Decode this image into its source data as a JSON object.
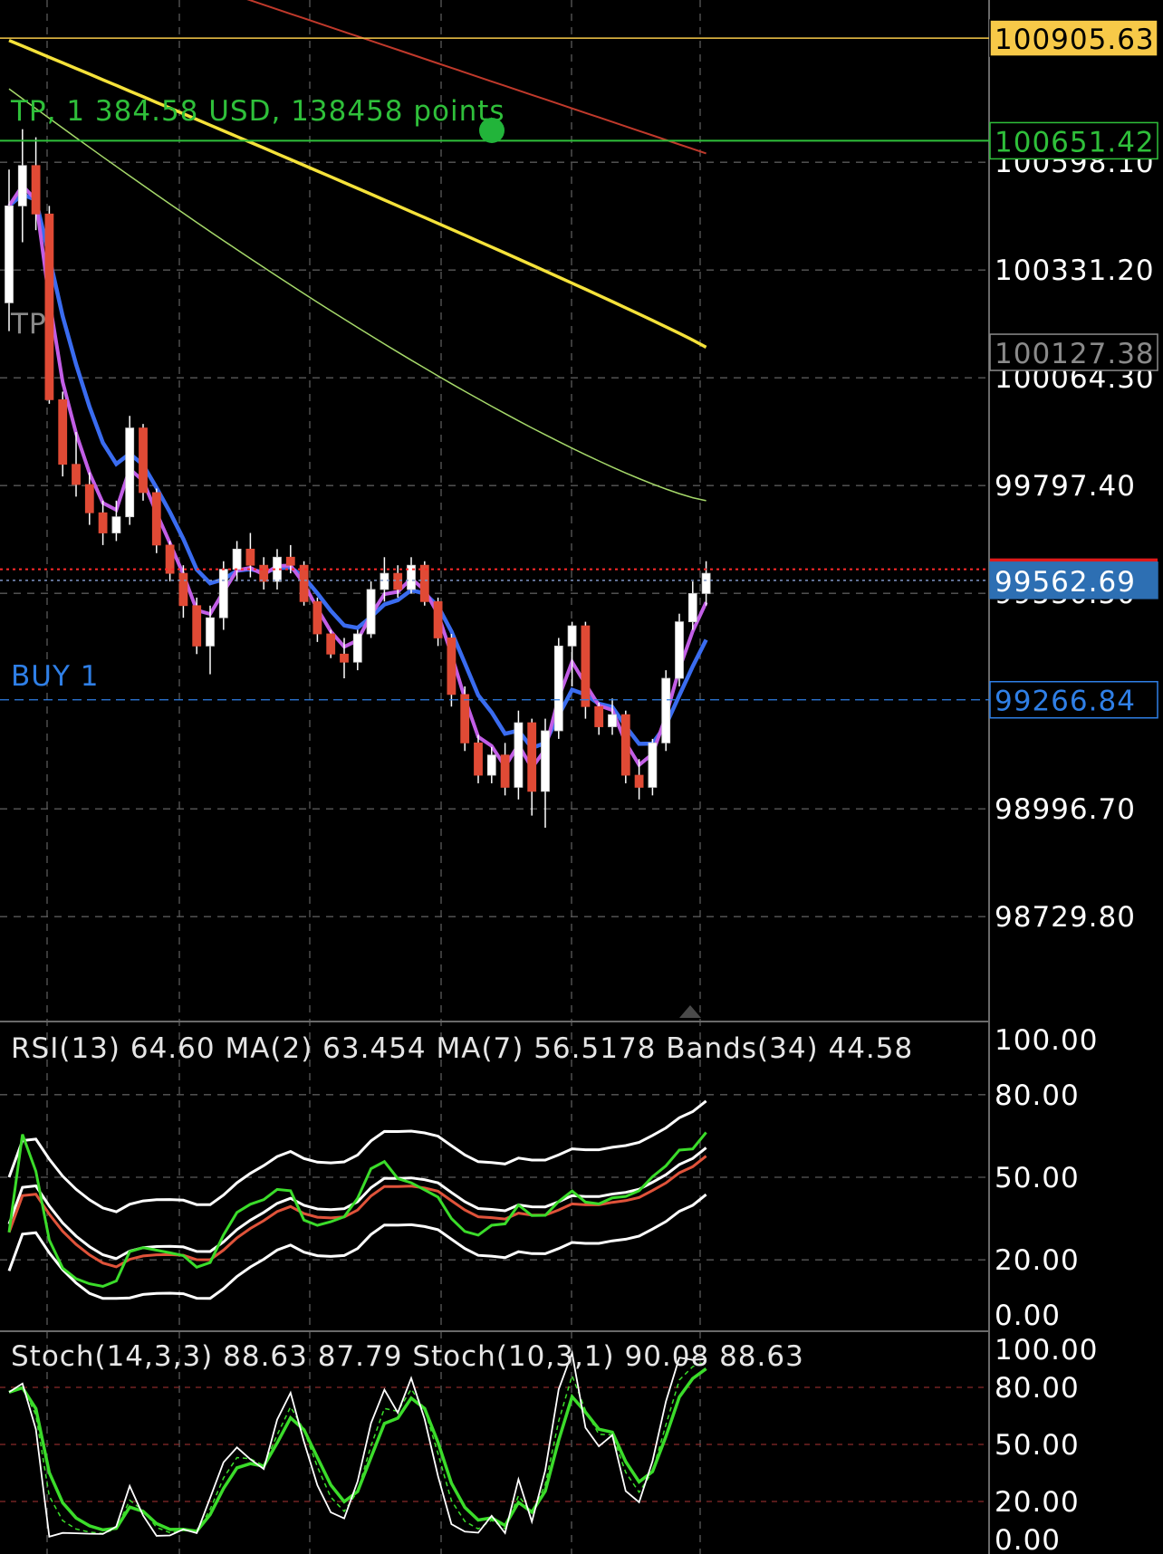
{
  "chart_data": {
    "type": "candlestick",
    "main": {
      "price_axis": {
        "ticks": [
          "100598.10",
          "100331.20",
          "100064.30",
          "99797.40",
          "99530.50",
          "98996.70",
          "98729.80"
        ],
        "range": [
          98470,
          101000
        ]
      },
      "price_tags": [
        {
          "label": "100905.63",
          "value": 100905.63,
          "kind": "bid-line",
          "bg": "#f7c948",
          "fg": "#000000"
        },
        {
          "label": "100651.42",
          "value": 100651.42,
          "kind": "tp-line",
          "bg": "#000000",
          "fg": "#2fbf3a"
        },
        {
          "label": "100127.38",
          "value": 100127.38,
          "kind": "tp-ghost",
          "bg": "#000000",
          "fg": "#8a8a8a"
        },
        {
          "label": "99562.69",
          "value": 99562.69,
          "kind": "current",
          "bg": "#2d6fb3",
          "fg": "#ffffff"
        },
        {
          "label": "99266.84",
          "value": 99266.84,
          "kind": "buy-line",
          "bg": "#000000",
          "fg": "#2f7fe6"
        }
      ],
      "ask_value": 99590,
      "annotations": [
        {
          "text": "TP, 1 384.58 USD, 138458 points",
          "color": "#2fbf3a"
        },
        {
          "text": "TP",
          "color": "#8a8a8a"
        },
        {
          "text": "BUY 1",
          "color": "#2f7fe6"
        }
      ],
      "candles": [
        [
          100250,
          100580,
          100180,
          100490
        ],
        [
          100490,
          100680,
          100400,
          100590
        ],
        [
          100590,
          100660,
          100430,
          100470
        ],
        [
          100470,
          100490,
          100000,
          100010
        ],
        [
          100010,
          100030,
          99820,
          99850
        ],
        [
          99850,
          99930,
          99770,
          99800
        ],
        [
          99800,
          99830,
          99700,
          99730
        ],
        [
          99730,
          99760,
          99650,
          99680
        ],
        [
          99680,
          99760,
          99660,
          99720
        ],
        [
          99720,
          99970,
          99700,
          99940
        ],
        [
          99940,
          99950,
          99760,
          99780
        ],
        [
          99780,
          99790,
          99630,
          99650
        ],
        [
          99650,
          99660,
          99560,
          99580
        ],
        [
          99580,
          99600,
          99470,
          99500
        ],
        [
          99500,
          99520,
          99380,
          99400
        ],
        [
          99400,
          99500,
          99330,
          99470
        ],
        [
          99470,
          99610,
          99440,
          99590
        ],
        [
          99590,
          99660,
          99560,
          99640
        ],
        [
          99640,
          99680,
          99570,
          99600
        ],
        [
          99600,
          99620,
          99540,
          99560
        ],
        [
          99560,
          99640,
          99540,
          99620
        ],
        [
          99620,
          99650,
          99580,
          99600
        ],
        [
          99600,
          99610,
          99500,
          99510
        ],
        [
          99510,
          99520,
          99410,
          99430
        ],
        [
          99430,
          99440,
          99370,
          99380
        ],
        [
          99380,
          99420,
          99320,
          99360
        ],
        [
          99360,
          99440,
          99340,
          99430
        ],
        [
          99430,
          99560,
          99420,
          99540
        ],
        [
          99540,
          99620,
          99510,
          99580
        ],
        [
          99580,
          99600,
          99520,
          99540
        ],
        [
          99540,
          99620,
          99530,
          99600
        ],
        [
          99600,
          99610,
          99500,
          99510
        ],
        [
          99510,
          99520,
          99400,
          99420
        ],
        [
          99420,
          99430,
          99250,
          99280
        ],
        [
          99280,
          99300,
          99140,
          99160
        ],
        [
          99160,
          99180,
          99060,
          99080
        ],
        [
          99080,
          99150,
          99060,
          99130
        ],
        [
          99130,
          99160,
          99030,
          99050
        ],
        [
          99050,
          99240,
          99020,
          99210
        ],
        [
          99210,
          99220,
          98980,
          99040
        ],
        [
          99040,
          99220,
          98950,
          99190
        ],
        [
          99190,
          99420,
          99170,
          99400
        ],
        [
          99400,
          99460,
          99300,
          99450
        ],
        [
          99450,
          99460,
          99220,
          99250
        ],
        [
          99250,
          99260,
          99180,
          99200
        ],
        [
          99200,
          99270,
          99180,
          99230
        ],
        [
          99230,
          99240,
          99060,
          99080
        ],
        [
          99080,
          99120,
          99020,
          99050
        ],
        [
          99050,
          99170,
          99030,
          99160
        ],
        [
          99160,
          99340,
          99140,
          99320
        ],
        [
          99320,
          99480,
          99300,
          99460
        ],
        [
          99460,
          99560,
          99440,
          99530
        ],
        [
          99530,
          99610,
          99500,
          99580
        ]
      ],
      "sma_yellow_end": 100140,
      "sma_red_end": 100620,
      "sma_green_end": 99760,
      "ema_blue_end": 99380,
      "ema_magenta_end": 99450
    },
    "rsi": {
      "title": "RSI(13) 64.60 MA(2) 63.454 MA(7) 56.5178 Bands(34) 44.58",
      "ticks": [
        "100.00",
        "80.00",
        "50.00",
        "20.00",
        "0.00"
      ],
      "range": [
        0,
        100
      ],
      "levels": [
        80,
        50,
        20
      ],
      "rsi_value": 64.6
    },
    "stoch": {
      "title": "Stoch(14,3,3) 88.63 87.79 Stoch(10,3,1) 90.08 88.63",
      "ticks": [
        "100.00",
        "80.00",
        "50.00",
        "20.00",
        "0.00"
      ],
      "range": [
        0,
        100
      ],
      "levels": [
        80,
        50,
        20
      ]
    },
    "colors": {
      "background": "#000000",
      "grid": "#5a5a5a",
      "bull": "#ffffff",
      "bear": "#e04a35",
      "yellow_ma": "#f5e23a",
      "red_ma": "#c0392b",
      "green_ma": "#a6d96a",
      "blue_ma": "#3a6cf0",
      "magenta_ma": "#c25ee6",
      "rsi": "#3bdc2a",
      "rsi_ma": "#e0533a",
      "bands": "#ffffff",
      "stoch_main": "#3bdc2a",
      "stoch_fast": "#ffffff",
      "ask": "#ff2a2a",
      "bid": "#7f96c8",
      "text": "#e6e6e6",
      "axis_text": "#ffffff"
    }
  }
}
